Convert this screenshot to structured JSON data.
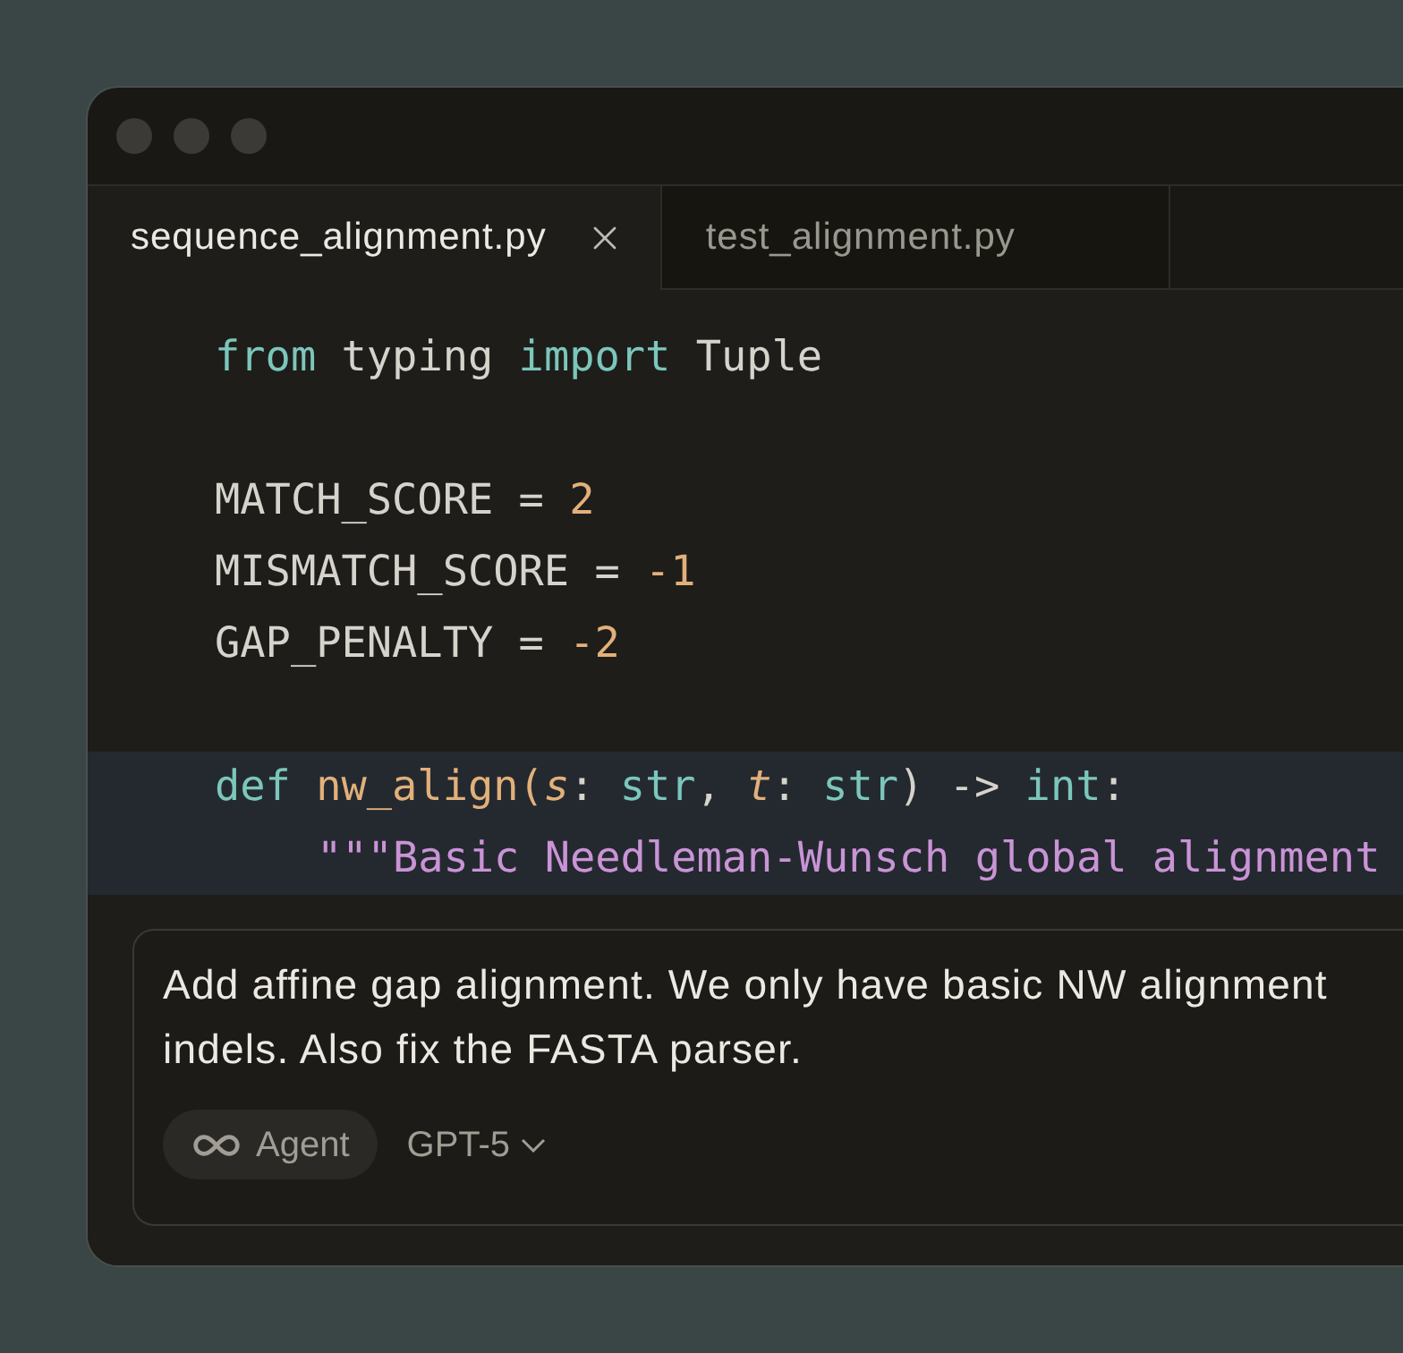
{
  "tabs": [
    {
      "label": "sequence_alignment.py",
      "selected": true,
      "closable": true
    },
    {
      "label": "test_alignment.py",
      "selected": false,
      "closable": false
    }
  ],
  "code": [
    {
      "kind": "code",
      "highlighted": false,
      "tokens": [
        {
          "kind": "keyword",
          "text": "from "
        },
        {
          "kind": "plain",
          "text": "typing "
        },
        {
          "kind": "keyword",
          "text": "import "
        },
        {
          "kind": "plain",
          "text": "Tuple"
        }
      ]
    },
    {
      "kind": "blank",
      "highlighted": false
    },
    {
      "kind": "code",
      "highlighted": false,
      "tokens": [
        {
          "kind": "plain",
          "text": "MATCH_SCORE = "
        },
        {
          "kind": "number",
          "text": "2"
        }
      ]
    },
    {
      "kind": "code",
      "highlighted": false,
      "tokens": [
        {
          "kind": "plain",
          "text": "MISMATCH_SCORE = "
        },
        {
          "kind": "number",
          "text": "-1"
        }
      ]
    },
    {
      "kind": "code",
      "highlighted": false,
      "tokens": [
        {
          "kind": "plain",
          "text": "GAP_PENALTY = "
        },
        {
          "kind": "number",
          "text": "-2"
        }
      ]
    },
    {
      "kind": "blank",
      "highlighted": false
    },
    {
      "kind": "code",
      "highlighted": true,
      "tokens": [
        {
          "kind": "keyword",
          "text": "def "
        },
        {
          "kind": "function",
          "text": "nw_align("
        },
        {
          "kind": "param",
          "text": "s"
        },
        {
          "kind": "plain",
          "text": ": "
        },
        {
          "kind": "keyword",
          "text": "str"
        },
        {
          "kind": "plain",
          "text": ", "
        },
        {
          "kind": "param",
          "text": "t"
        },
        {
          "kind": "plain",
          "text": ": "
        },
        {
          "kind": "keyword",
          "text": "str"
        },
        {
          "kind": "plain",
          "text": ") -> "
        },
        {
          "kind": "keyword",
          "text": "int"
        },
        {
          "kind": "plain",
          "text": ":"
        }
      ]
    },
    {
      "kind": "indented",
      "highlighted": true,
      "tokens": [
        {
          "kind": "string",
          "text": "\"\"\"Basic Needleman-Wunsch global alignment"
        }
      ]
    }
  ],
  "composer": {
    "lines": [
      "Add affine gap alignment. We only have basic NW alignment",
      "indels. Also fix the FASTA parser."
    ],
    "mode": {
      "label": "Agent"
    },
    "model": {
      "label": "GPT-5"
    }
  }
}
